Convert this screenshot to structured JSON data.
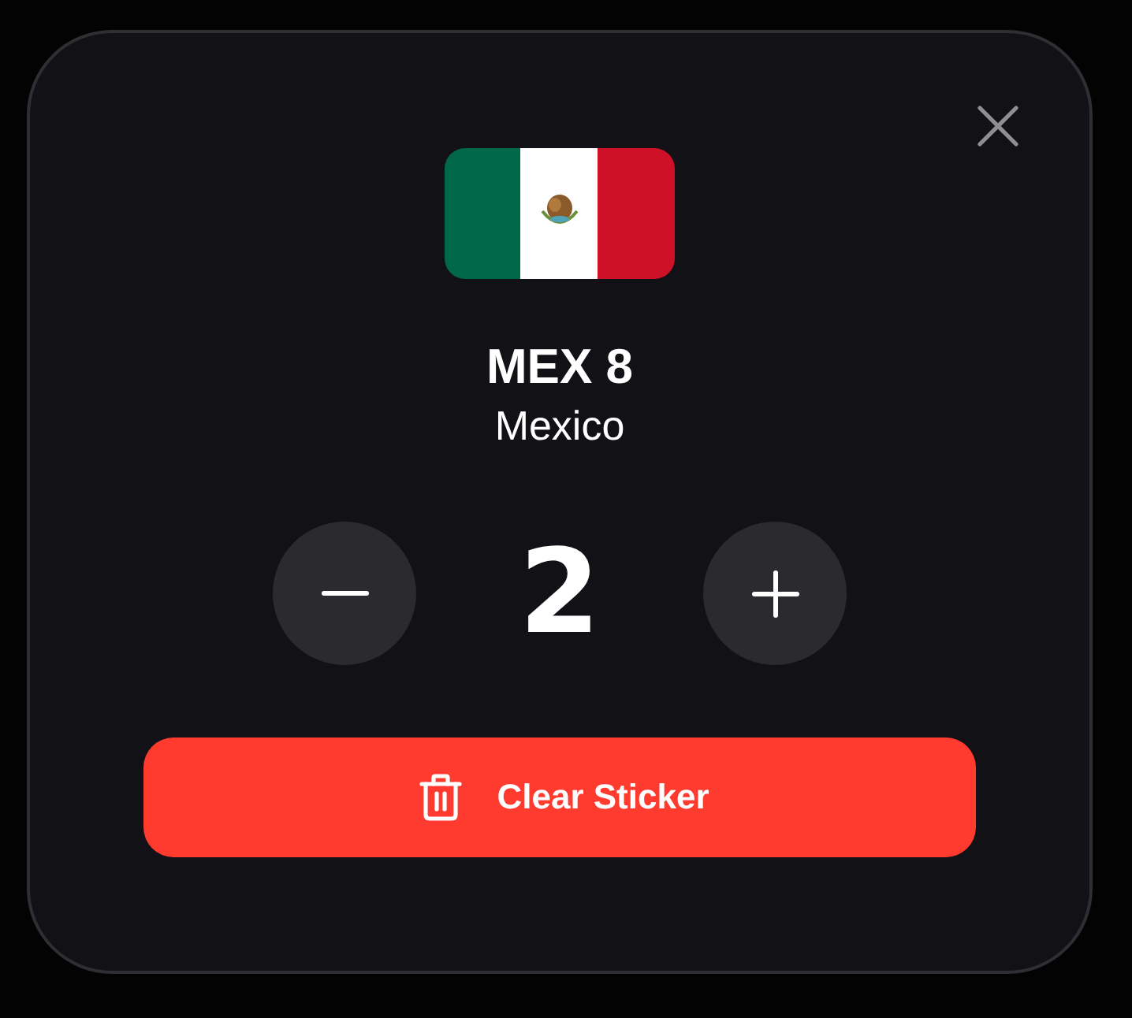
{
  "sticker": {
    "code": "MEX 8",
    "country": "Mexico"
  },
  "counter": {
    "value": "2"
  },
  "clear_button": {
    "label": "Clear Sticker"
  }
}
